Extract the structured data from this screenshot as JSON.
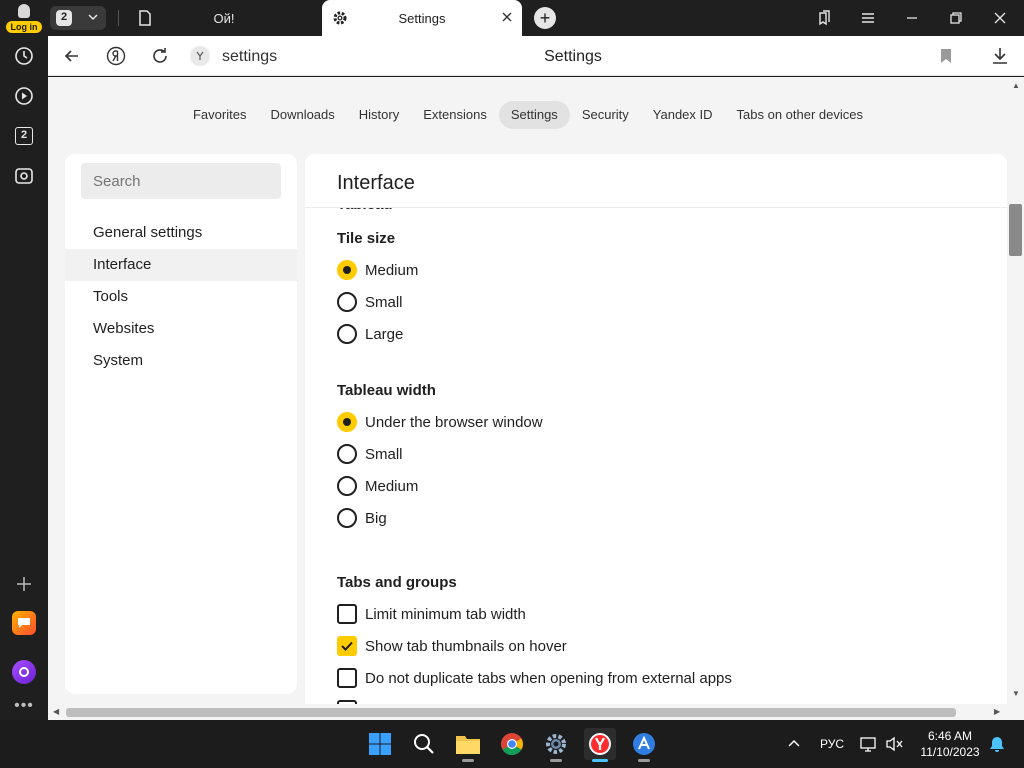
{
  "sidebar": {
    "login_label": "Log in",
    "icons": [
      "history-icon",
      "play-icon",
      "tab-counter-icon",
      "screenshot-icon",
      "add-icon",
      "messenger-icon",
      "alice-icon",
      "more-icon"
    ],
    "tab_counter": "2"
  },
  "tabstrip": {
    "tab_count": "2",
    "tabs": [
      {
        "label": "Ой!",
        "active": false
      },
      {
        "label": "Settings",
        "active": true
      }
    ]
  },
  "addressbar": {
    "url": "settings",
    "page_title": "Settings"
  },
  "nav": {
    "tabs": [
      "Favorites",
      "Downloads",
      "History",
      "Extensions",
      "Settings",
      "Security",
      "Yandex ID",
      "Tabs on other devices"
    ],
    "active": "Settings"
  },
  "leftpanel": {
    "search_placeholder": "Search",
    "items": [
      "General settings",
      "Interface",
      "Tools",
      "Websites",
      "System"
    ],
    "active": "Interface"
  },
  "main": {
    "title": "Interface",
    "clipped_heading": "Tableau",
    "tile_size": {
      "heading": "Tile size",
      "options": [
        "Medium",
        "Small",
        "Large"
      ],
      "selected": "Medium"
    },
    "tableau_width": {
      "heading": "Tableau width",
      "options": [
        "Under the browser window",
        "Small",
        "Medium",
        "Big"
      ],
      "selected": "Under the browser window"
    },
    "tabs_groups": {
      "heading": "Tabs and groups",
      "options": [
        {
          "label": "Limit minimum tab width",
          "checked": false
        },
        {
          "label": "Show tab thumbnails on hover",
          "checked": true
        },
        {
          "label": "Do not duplicate tabs when opening from external apps",
          "checked": false
        }
      ]
    }
  },
  "taskbar": {
    "apps": [
      "windows-start-icon",
      "search-icon",
      "file-explorer-icon",
      "chrome-icon",
      "settings-app-icon",
      "yandex-browser-icon",
      "app-icon"
    ],
    "language": "РУС",
    "time": "6:46 AM",
    "date": "11/10/2023"
  },
  "colors": {
    "accent": "#ffcc00",
    "dark": "#1f1f1f"
  }
}
